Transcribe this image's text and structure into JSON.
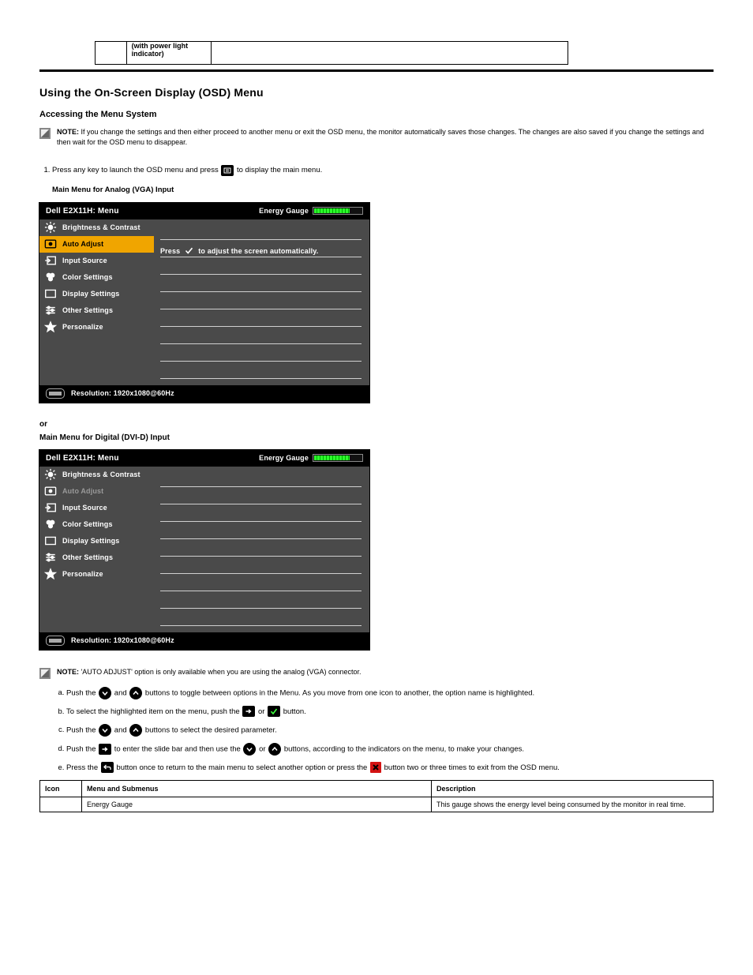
{
  "top_fragment": {
    "label_suffix": "(with power light indicator)"
  },
  "section_title": "Using the On-Screen Display (OSD) Menu",
  "sub_title": "Accessing the Menu System",
  "note1_label": "NOTE:",
  "note1_text": "If you change the settings and then either proceed to another menu or exit the OSD menu, the monitor automatically saves those changes. The changes are also saved if you change the settings and then wait for the OSD menu to disappear.",
  "intro_step1": "Press any key to launch the OSD menu and press",
  "intro_step1_tail": "to display the main menu.",
  "main_menu_vga": "Main Menu for Analog (VGA) Input",
  "or_label": "or",
  "main_menu_digital": "Main Menu for Digital (DVI-D) Input",
  "osd": {
    "title": "Dell E2X11H: Menu",
    "energy_label": "Energy Gauge",
    "items": [
      {
        "name": "brightness",
        "label": "Brightness & Contrast"
      },
      {
        "name": "autoadjust",
        "label": "Auto Adjust"
      },
      {
        "name": "input",
        "label": "Input Source"
      },
      {
        "name": "color",
        "label": "Color Settings"
      },
      {
        "name": "display",
        "label": "Display Settings"
      },
      {
        "name": "other",
        "label": "Other Settings"
      },
      {
        "name": "personalize",
        "label": "Personalize"
      }
    ],
    "press_prefix": "Press",
    "press_suffix": "to adjust the screen automatically.",
    "resolution_label": "Resolution: 1920x1080@60Hz"
  },
  "note2_label": "NOTE:",
  "note2_text": "'AUTO ADJUST' option is only available when you are using the analog (VGA) connector.",
  "steps": {
    "a": {
      "pre": "Push the",
      "mid": "and",
      "post": "buttons to toggle between options in the Menu. As you move from one icon to another, the option name is highlighted."
    },
    "b": {
      "pre": "To select the highlighted item on the menu, push the",
      "mid": "or",
      "post": "button."
    },
    "c": {
      "pre": "Push the",
      "mid": "and",
      "post": "buttons to select the desired parameter."
    },
    "d": {
      "pre": "Push the",
      "mid1": "to enter the slide bar and then use the",
      "mid2": "or",
      "post": "buttons, according to the indicators on the menu, to make your changes."
    },
    "e": {
      "pre": "Press the",
      "mid": "button once to return to the main menu to select another option or press the",
      "post": "button two or three times to exit from the OSD menu."
    }
  },
  "fw_headers": {
    "icon": "Icon",
    "menu": "Menu and Submenus",
    "desc": "Description"
  },
  "fw_row1": {
    "menu": "Energy Gauge",
    "desc": "This gauge shows the energy level being consumed by the monitor in real time."
  }
}
